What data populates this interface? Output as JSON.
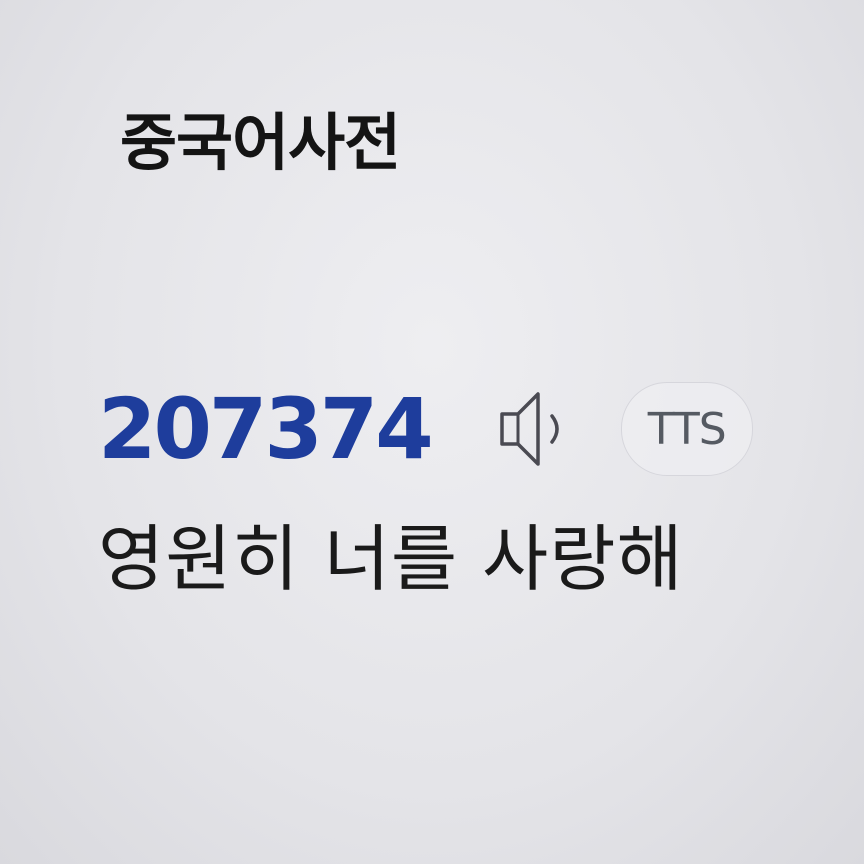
{
  "app": {
    "title": "중국어사전"
  },
  "entry": {
    "word": "207374",
    "speaker_icon": "speaker-icon",
    "tts_label": "TTS",
    "meaning": "영원히 너를 사랑해"
  },
  "colors": {
    "word": "#1e3d9c",
    "text": "#1a1a1a",
    "tts_text": "#555a62",
    "background": "#e6e6ea"
  }
}
